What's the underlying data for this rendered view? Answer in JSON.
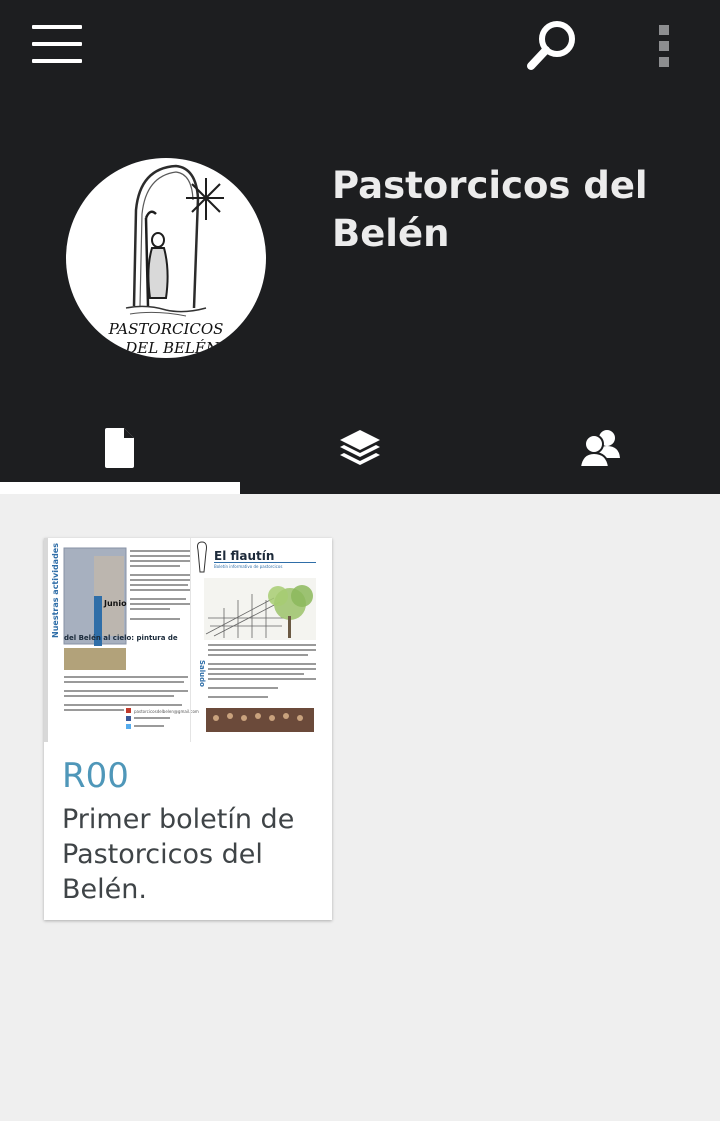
{
  "appbar": {
    "menu_icon": "hamburger-menu-icon",
    "search_icon": "search-icon",
    "more_icon": "overflow-menu-icon",
    "background": "#1d1e20"
  },
  "profile": {
    "name": "Pastorcicos del Belén",
    "logo_text_line1": "PASTORCICOS",
    "logo_text_line2": "DEL BELÉN."
  },
  "tabs": [
    {
      "icon": "document-icon",
      "selected": true
    },
    {
      "icon": "layers-icon",
      "selected": false
    },
    {
      "icon": "people-icon",
      "selected": false
    }
  ],
  "publications": [
    {
      "code": "R00",
      "description": "Primer boletín de Pastorcicos del Belén.",
      "thumbnail": {
        "left_heading": "Nuestras actividades",
        "month": "Junio",
        "caption": "del Belén al cielo: pintura de",
        "title": "El flautín",
        "subtitle": "Boletín informativo de pastorcicos",
        "side_label": "Saludo",
        "email": "pastorcicosdelbelen@gmail.com"
      }
    }
  ],
  "colors": {
    "accent_code": "#4f97b9",
    "description_text": "#3f4447",
    "page_background": "#efefef"
  }
}
